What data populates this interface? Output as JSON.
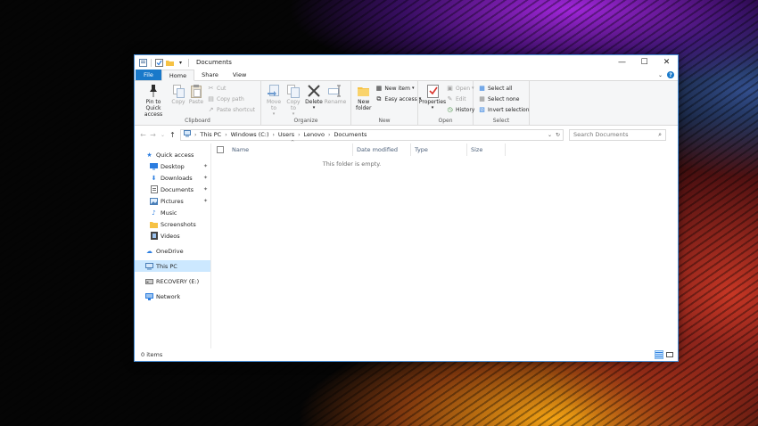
{
  "window": {
    "title": "Documents",
    "qat_icons": [
      "properties-icon",
      "checkmark-icon",
      "folder-icon"
    ],
    "controls": {
      "minimize": "—",
      "maximize": "☐",
      "close": "✕"
    }
  },
  "tabs": {
    "file": "File",
    "home": "Home",
    "share": "Share",
    "view": "View",
    "help": "?"
  },
  "ribbon": {
    "clipboard": {
      "label": "Clipboard",
      "pin": "Pin to Quick access",
      "copy": "Copy",
      "paste": "Paste",
      "cut": "Cut",
      "copy_path": "Copy path",
      "paste_shortcut": "Paste shortcut"
    },
    "organize": {
      "label": "Organize",
      "move_to": "Move to",
      "copy_to": "Copy to",
      "delete": "Delete",
      "rename": "Rename"
    },
    "new": {
      "label": "New",
      "new_folder": "New folder",
      "new_item": "New item",
      "easy_access": "Easy access"
    },
    "open": {
      "label": "Open",
      "properties": "Properties",
      "open": "Open",
      "edit": "Edit",
      "history": "History"
    },
    "select": {
      "label": "Select",
      "select_all": "Select all",
      "select_none": "Select none",
      "invert_selection": "Invert selection"
    }
  },
  "address": {
    "crumbs": [
      "This PC",
      "Windows (C:)",
      "Users",
      "Lenovo",
      "Documents"
    ],
    "search_placeholder": "Search Documents"
  },
  "navpane": {
    "quick_access": "Quick access",
    "desktop": "Desktop",
    "downloads": "Downloads",
    "documents": "Documents",
    "pictures": "Pictures",
    "music": "Music",
    "screenshots": "Screenshots",
    "videos": "Videos",
    "onedrive": "OneDrive",
    "this_pc": "This PC",
    "recovery": "RECOVERY (E:)",
    "network": "Network"
  },
  "content": {
    "columns": {
      "name": "Name",
      "date_modified": "Date modified",
      "type": "Type",
      "size": "Size"
    },
    "empty_message": "This folder is empty."
  },
  "status": {
    "item_count": "0 items"
  },
  "colors": {
    "accent": "#1979ca",
    "selection": "#cce8ff",
    "folder": "#f6c244"
  }
}
